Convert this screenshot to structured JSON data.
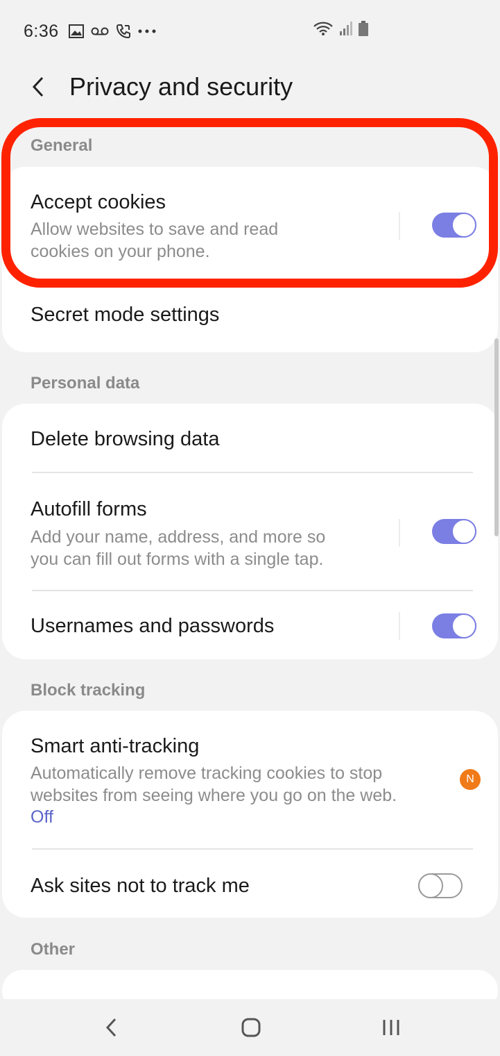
{
  "status_bar": {
    "time": "6:36",
    "icons_left": [
      "image-icon",
      "voicemail-icon",
      "call-icon",
      "more-icon"
    ],
    "icons_right": [
      "wifi-icon",
      "signal-icon",
      "battery-icon"
    ]
  },
  "header": {
    "title": "Privacy and security",
    "back_icon": "chevron-left-icon"
  },
  "sections": {
    "general": "General",
    "personal_data": "Personal data",
    "block_tracking": "Block tracking",
    "other": "Other"
  },
  "general": {
    "accept_cookies": {
      "title": "Accept cookies",
      "desc_line1": "Allow websites to save and read",
      "desc_line2": "cookies on your phone.",
      "enabled": true
    },
    "secret_mode": {
      "title": "Secret mode settings"
    }
  },
  "personal": {
    "delete_browsing": {
      "title": "Delete browsing data"
    },
    "autofill": {
      "title": "Autofill forms",
      "desc_line1": "Add your name, address, and more so",
      "desc_line2": "you can fill out forms with a single tap.",
      "enabled": true
    },
    "usernames": {
      "title": "Usernames and passwords",
      "enabled": true
    }
  },
  "tracking": {
    "smart_anti": {
      "title": "Smart anti-tracking",
      "desc_line1": "Automatically remove tracking cookies to stop",
      "desc_line2": "websites from seeing where you go on the web.",
      "status": "Off",
      "badge": "N"
    },
    "ask_sites": {
      "title": "Ask sites not to track me",
      "enabled": false
    }
  },
  "colors": {
    "accent": "#7b7ee3",
    "highlight": "#ff2200",
    "badge": "#f07a18",
    "status_link": "#5a64c8"
  },
  "nav_bar": {
    "back": "nav-back-icon",
    "home": "nav-home-icon",
    "recents": "nav-recents-icon"
  }
}
